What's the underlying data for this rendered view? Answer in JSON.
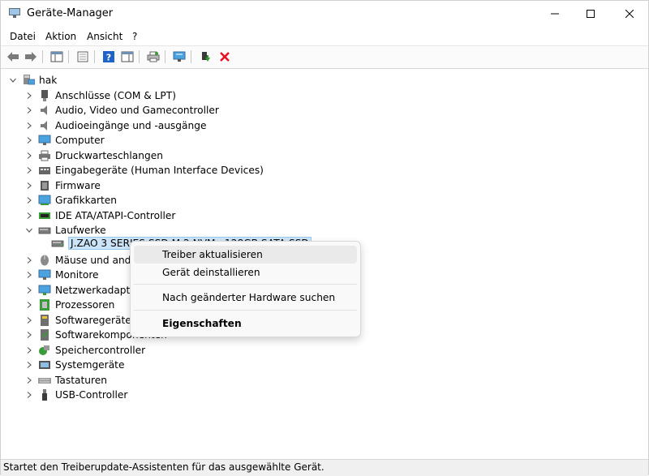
{
  "window": {
    "title": "Geräte-Manager"
  },
  "menu": [
    "Datei",
    "Aktion",
    "Ansicht",
    "?"
  ],
  "tree": {
    "root": "hak",
    "categories": [
      {
        "label": "Anschlüsse (COM & LPT)",
        "icon": "port-icon"
      },
      {
        "label": "Audio, Video und Gamecontroller",
        "icon": "speaker-icon"
      },
      {
        "label": "Audioeingänge und -ausgänge",
        "icon": "speaker-icon"
      },
      {
        "label": "Computer",
        "icon": "monitor-icon"
      },
      {
        "label": "Druckwarteschlangen",
        "icon": "printer-icon"
      },
      {
        "label": "Eingabegeräte (Human Interface Devices)",
        "icon": "hid-icon"
      },
      {
        "label": "Firmware",
        "icon": "chip-icon"
      },
      {
        "label": "Grafikkarten",
        "icon": "display-adapter-icon"
      },
      {
        "label": "IDE ATA/ATAPI-Controller",
        "icon": "controller-icon"
      },
      {
        "label": "Laufwerke",
        "icon": "drive-icon",
        "expanded": true
      },
      {
        "label": "Mäuse und andere Zeigegeräte",
        "icon": "mouse-icon"
      },
      {
        "label": "Monitore",
        "icon": "monitor-icon"
      },
      {
        "label": "Netzwerkadapter",
        "icon": "network-icon"
      },
      {
        "label": "Prozessoren",
        "icon": "cpu-icon"
      },
      {
        "label": "Softwaregeräte",
        "icon": "software-device-icon"
      },
      {
        "label": "Softwarekomponenten",
        "icon": "software-component-icon"
      },
      {
        "label": "Speichercontroller",
        "icon": "storage-controller-icon"
      },
      {
        "label": "Systemgeräte",
        "icon": "system-device-icon"
      },
      {
        "label": "Tastaturen",
        "icon": "keyboard-icon"
      },
      {
        "label": "USB-Controller",
        "icon": "usb-icon"
      }
    ],
    "selected_device": "J.ZAO 3 SERIES SSD M.2 NVMe 128GB SATA SSD"
  },
  "context_menu": {
    "items": [
      "Treiber aktualisieren",
      "Gerät deinstallieren",
      "Nach geänderter Hardware suchen",
      "Eigenschaften"
    ]
  },
  "status": {
    "text": "Startet den Treiberupdate-Assistenten für das ausgewählte Gerät."
  },
  "colors": {
    "selection": "#cce4f7",
    "close_red": "#e81123",
    "accent_blue": "#1e64c8"
  }
}
